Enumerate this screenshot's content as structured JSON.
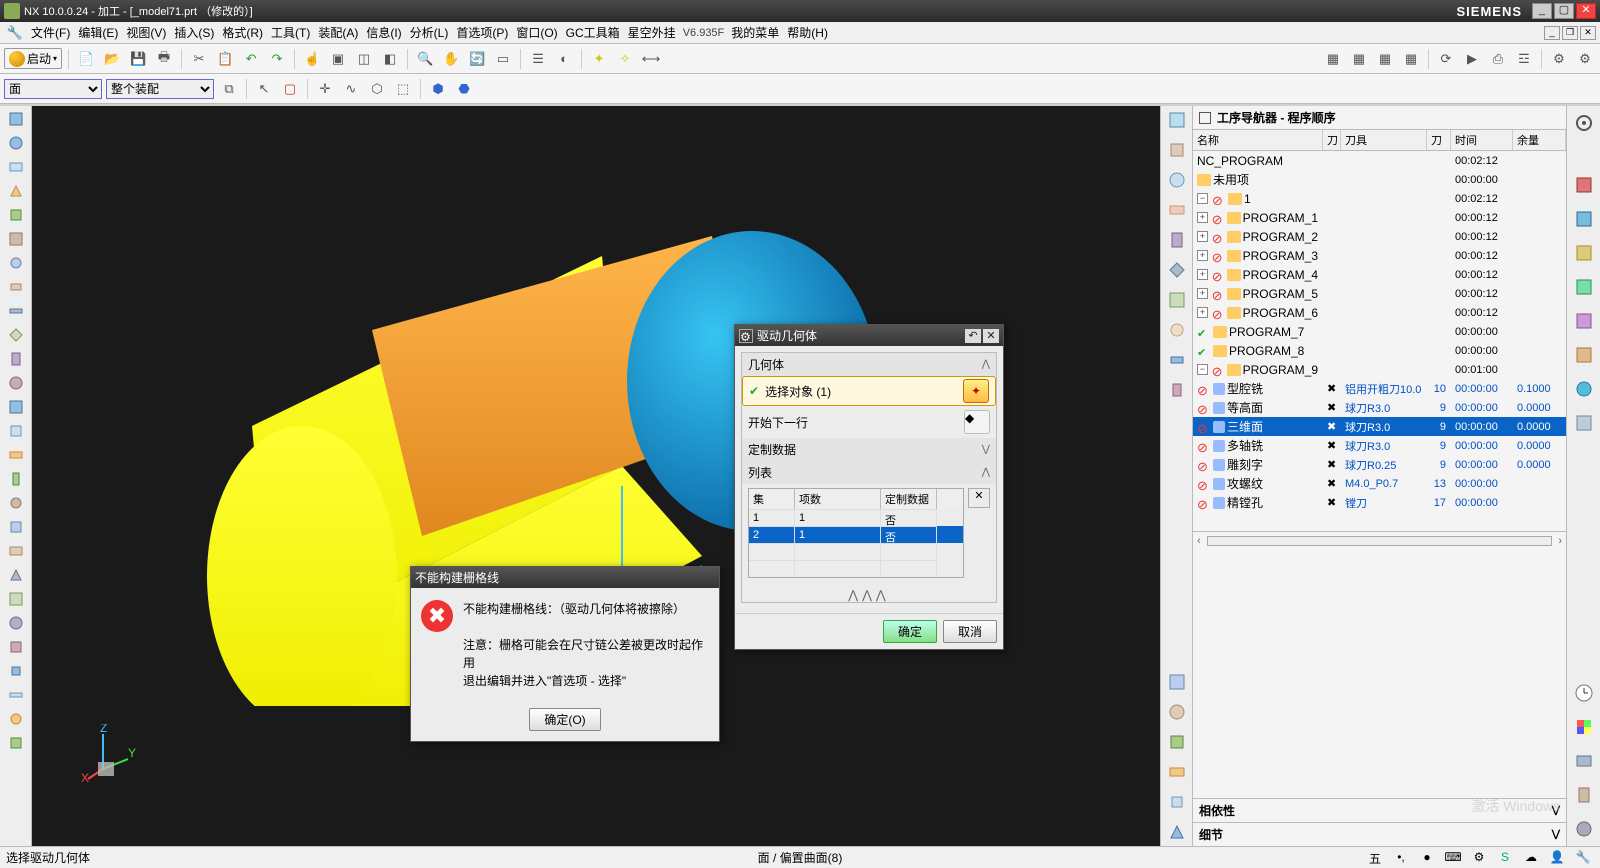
{
  "title": "NX 10.0.0.24 - 加工 - [_model71.prt （修改的）]",
  "brand": "SIEMENS",
  "menu": [
    "文件(F)",
    "编辑(E)",
    "视图(V)",
    "插入(S)",
    "格式(R)",
    "工具(T)",
    "装配(A)",
    "信息(I)",
    "分析(L)",
    "首选项(P)",
    "窗口(O)",
    "GC工具箱",
    "星空外挂",
    "我的菜单",
    "帮助(H)"
  ],
  "plugin_ver": "V6.935F",
  "start_label": "启动",
  "sel_face": "面",
  "sel_asm": "整个装配",
  "nav": {
    "title": "工序导航器 - 程序顺序",
    "cols": [
      "名称",
      "刀",
      "刀具",
      "刀",
      "时间",
      "余量"
    ],
    "root": "NC_PROGRAM",
    "root_time": "00:02:12",
    "unused": "未用项",
    "unused_time": "00:00:00",
    "g1": "1",
    "g1_time": "00:02:12",
    "progs": [
      {
        "n": "PROGRAM_1",
        "t": "00:00:12"
      },
      {
        "n": "PROGRAM_2",
        "t": "00:00:12"
      },
      {
        "n": "PROGRAM_3",
        "t": "00:00:12"
      },
      {
        "n": "PROGRAM_4",
        "t": "00:00:12"
      },
      {
        "n": "PROGRAM_5",
        "t": "00:00:12"
      },
      {
        "n": "PROGRAM_6",
        "t": "00:00:12"
      },
      {
        "n": "PROGRAM_7",
        "t": "00:00:00"
      },
      {
        "n": "PROGRAM_8",
        "t": "00:00:00"
      }
    ],
    "p9": "PROGRAM_9",
    "p9_time": "00:01:00",
    "ops": [
      {
        "n": "型腔铣",
        "tool": "铝用开粗刀10.0",
        "tn": "10",
        "t": "00:00:00",
        "r": "0.1000"
      },
      {
        "n": "等高面",
        "tool": "球刀R3.0",
        "tn": "9",
        "t": "00:00:00",
        "r": "0.0000"
      },
      {
        "n": "三维面",
        "tool": "球刀R3.0",
        "tn": "9",
        "t": "00:00:00",
        "r": "0.0000"
      },
      {
        "n": "多轴铣",
        "tool": "球刀R3.0",
        "tn": "9",
        "t": "00:00:00",
        "r": "0.0000"
      },
      {
        "n": "雕刻字",
        "tool": "球刀R0.25",
        "tn": "9",
        "t": "00:00:00",
        "r": "0.0000"
      },
      {
        "n": "攻螺纹",
        "tool": "M4.0_P0.7",
        "tn": "13",
        "t": "00:00:00",
        "r": ""
      },
      {
        "n": "精镗孔",
        "tool": "镗刀",
        "tn": "17",
        "t": "00:00:00",
        "r": ""
      }
    ],
    "dep": "相依性",
    "det": "细节"
  },
  "drv_dlg": {
    "title": "驱动几何体",
    "sec_geom": "几何体",
    "sel_obj": "选择对象 (1)",
    "next_row": "开始下一行",
    "sec_custom": "定制数据",
    "sec_list": "列表",
    "th_set": "集",
    "th_cnt": "项数",
    "th_cd": "定制数据",
    "rows": [
      {
        "s": "1",
        "c": "1",
        "d": "否"
      },
      {
        "s": "2",
        "c": "1",
        "d": "否"
      }
    ],
    "ok": "确定",
    "cancel": "取消"
  },
  "err_dlg": {
    "title": "不能构建栅格线",
    "line1": "不能构建栅格线：（驱动几何体将被擦除）",
    "line2": "注意：栅格可能会在尺寸链公差被更改时起作用",
    "line3": "退出编辑并进入\"首选项 - 选择\"",
    "ok": "确定(O)"
  },
  "status": {
    "left": "选择驱动几何体",
    "center": "面 / 偏置曲面(8)"
  },
  "axes": {
    "zm": "ZM",
    "ym": "YM",
    "xm": "XM"
  },
  "watermark": "激活 Windows"
}
